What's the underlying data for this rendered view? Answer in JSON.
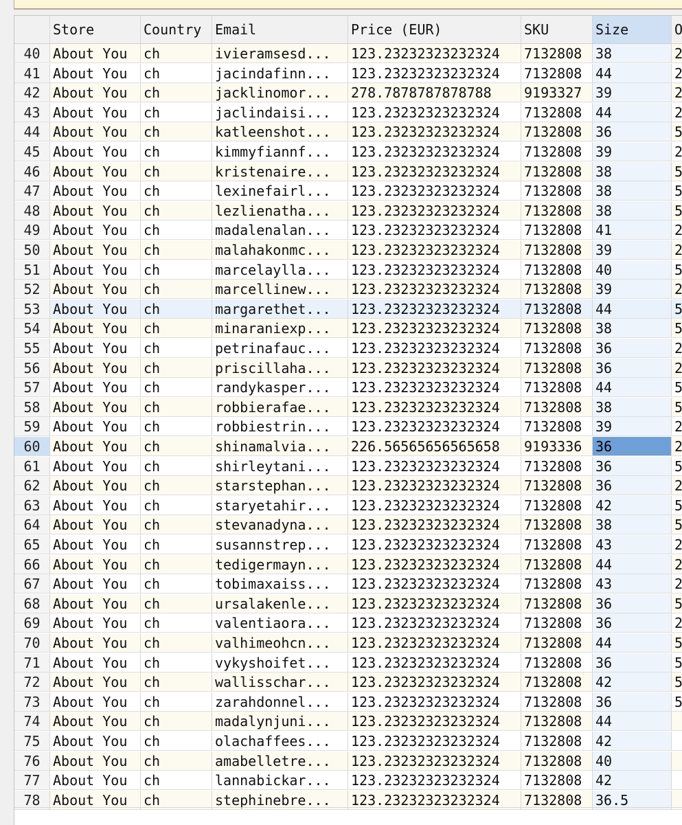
{
  "columns": [
    "Store",
    "Country",
    "Email",
    "Price (EUR)",
    "SKU",
    "Size",
    "O"
  ],
  "selected_column": "Size",
  "active_row": "60",
  "highlight_rows": [
    "53"
  ],
  "rows": [
    {
      "n": "40",
      "store": "About You",
      "country": "ch",
      "email": "ivieramsesd...",
      "price": "123.23232323232324",
      "sku": "7132808",
      "size": "38",
      "o": "2"
    },
    {
      "n": "41",
      "store": "About You",
      "country": "ch",
      "email": "jacindafinn...",
      "price": "123.23232323232324",
      "sku": "7132808",
      "size": "44",
      "o": "2"
    },
    {
      "n": "42",
      "store": "About You",
      "country": "ch",
      "email": "jacklinomor...",
      "price": "278.7878787878788",
      "sku": "9193327",
      "size": "39",
      "o": "2"
    },
    {
      "n": "43",
      "store": "About You",
      "country": "ch",
      "email": "jaclindaisi...",
      "price": "123.23232323232324",
      "sku": "7132808",
      "size": "44",
      "o": "2"
    },
    {
      "n": "44",
      "store": "About You",
      "country": "ch",
      "email": "katleenshot...",
      "price": "123.23232323232324",
      "sku": "7132808",
      "size": "36",
      "o": "5"
    },
    {
      "n": "45",
      "store": "About You",
      "country": "ch",
      "email": "kimmyfiannf...",
      "price": "123.23232323232324",
      "sku": "7132808",
      "size": "39",
      "o": "2"
    },
    {
      "n": "46",
      "store": "About You",
      "country": "ch",
      "email": "kristenaire...",
      "price": "123.23232323232324",
      "sku": "7132808",
      "size": "38",
      "o": "5"
    },
    {
      "n": "47",
      "store": "About You",
      "country": "ch",
      "email": "lexinefairl...",
      "price": "123.23232323232324",
      "sku": "7132808",
      "size": "38",
      "o": "5"
    },
    {
      "n": "48",
      "store": "About You",
      "country": "ch",
      "email": "lezlienatha...",
      "price": "123.23232323232324",
      "sku": "7132808",
      "size": "38",
      "o": "5"
    },
    {
      "n": "49",
      "store": "About You",
      "country": "ch",
      "email": "madalenalan...",
      "price": "123.23232323232324",
      "sku": "7132808",
      "size": "41",
      "o": "2"
    },
    {
      "n": "50",
      "store": "About You",
      "country": "ch",
      "email": "malahakonmc...",
      "price": "123.23232323232324",
      "sku": "7132808",
      "size": "39",
      "o": "2"
    },
    {
      "n": "51",
      "store": "About You",
      "country": "ch",
      "email": "marcelaylla...",
      "price": "123.23232323232324",
      "sku": "7132808",
      "size": "40",
      "o": "5"
    },
    {
      "n": "52",
      "store": "About You",
      "country": "ch",
      "email": "marcellinew...",
      "price": "123.23232323232324",
      "sku": "7132808",
      "size": "39",
      "o": "2"
    },
    {
      "n": "53",
      "store": "About You",
      "country": "ch",
      "email": "margarethet...",
      "price": "123.23232323232324",
      "sku": "7132808",
      "size": "44",
      "o": "5"
    },
    {
      "n": "54",
      "store": "About You",
      "country": "ch",
      "email": "minaraniexp...",
      "price": "123.23232323232324",
      "sku": "7132808",
      "size": "38",
      "o": "5"
    },
    {
      "n": "55",
      "store": "About You",
      "country": "ch",
      "email": "petrinafauc...",
      "price": "123.23232323232324",
      "sku": "7132808",
      "size": "36",
      "o": "2"
    },
    {
      "n": "56",
      "store": "About You",
      "country": "ch",
      "email": "priscillaha...",
      "price": "123.23232323232324",
      "sku": "7132808",
      "size": "36",
      "o": "2"
    },
    {
      "n": "57",
      "store": "About You",
      "country": "ch",
      "email": "randykasper...",
      "price": "123.23232323232324",
      "sku": "7132808",
      "size": "44",
      "o": "5"
    },
    {
      "n": "58",
      "store": "About You",
      "country": "ch",
      "email": "robbierafae...",
      "price": "123.23232323232324",
      "sku": "7132808",
      "size": "38",
      "o": "5"
    },
    {
      "n": "59",
      "store": "About You",
      "country": "ch",
      "email": "robbiestrin...",
      "price": "123.23232323232324",
      "sku": "7132808",
      "size": "39",
      "o": "2"
    },
    {
      "n": "60",
      "store": "About You",
      "country": "ch",
      "email": "shinamalvia...",
      "price": "226.56565656565658",
      "sku": "9193336",
      "size": "36",
      "o": "2"
    },
    {
      "n": "61",
      "store": "About You",
      "country": "ch",
      "email": "shirleytani...",
      "price": "123.23232323232324",
      "sku": "7132808",
      "size": "36",
      "o": "5"
    },
    {
      "n": "62",
      "store": "About You",
      "country": "ch",
      "email": "starstephan...",
      "price": "123.23232323232324",
      "sku": "7132808",
      "size": "36",
      "o": "2"
    },
    {
      "n": "63",
      "store": "About You",
      "country": "ch",
      "email": "staryetahir...",
      "price": "123.23232323232324",
      "sku": "7132808",
      "size": "42",
      "o": "5"
    },
    {
      "n": "64",
      "store": "About You",
      "country": "ch",
      "email": "stevanadyna...",
      "price": "123.23232323232324",
      "sku": "7132808",
      "size": "38",
      "o": "5"
    },
    {
      "n": "65",
      "store": "About You",
      "country": "ch",
      "email": "susannstrep...",
      "price": "123.23232323232324",
      "sku": "7132808",
      "size": "43",
      "o": "2"
    },
    {
      "n": "66",
      "store": "About You",
      "country": "ch",
      "email": "tedigermayn...",
      "price": "123.23232323232324",
      "sku": "7132808",
      "size": "44",
      "o": "2"
    },
    {
      "n": "67",
      "store": "About You",
      "country": "ch",
      "email": "tobimaxaiss...",
      "price": "123.23232323232324",
      "sku": "7132808",
      "size": "43",
      "o": "2"
    },
    {
      "n": "68",
      "store": "About You",
      "country": "ch",
      "email": "ursalakenle...",
      "price": "123.23232323232324",
      "sku": "7132808",
      "size": "36",
      "o": "5"
    },
    {
      "n": "69",
      "store": "About You",
      "country": "ch",
      "email": "valentiaora...",
      "price": "123.23232323232324",
      "sku": "7132808",
      "size": "36",
      "o": "2"
    },
    {
      "n": "70",
      "store": "About You",
      "country": "ch",
      "email": "valhimeohcn...",
      "price": "123.23232323232324",
      "sku": "7132808",
      "size": "44",
      "o": "5"
    },
    {
      "n": "71",
      "store": "About You",
      "country": "ch",
      "email": "vykyshoifet...",
      "price": "123.23232323232324",
      "sku": "7132808",
      "size": "36",
      "o": "5"
    },
    {
      "n": "72",
      "store": "About You",
      "country": "ch",
      "email": "wallisschar...",
      "price": "123.23232323232324",
      "sku": "7132808",
      "size": "42",
      "o": "5"
    },
    {
      "n": "73",
      "store": "About You",
      "country": "ch",
      "email": "zarahdonnel...",
      "price": "123.23232323232324",
      "sku": "7132808",
      "size": "36",
      "o": "5"
    },
    {
      "n": "74",
      "store": "About You",
      "country": "ch",
      "email": "madalynjuni...",
      "price": "123.23232323232324",
      "sku": "7132808",
      "size": "44",
      "o": ""
    },
    {
      "n": "75",
      "store": "About You",
      "country": "ch",
      "email": "olachaffees...",
      "price": "123.23232323232324",
      "sku": "7132808",
      "size": "42",
      "o": ""
    },
    {
      "n": "76",
      "store": "About You",
      "country": "ch",
      "email": "amabelletre...",
      "price": "123.23232323232324",
      "sku": "7132808",
      "size": "40",
      "o": ""
    },
    {
      "n": "77",
      "store": "About You",
      "country": "ch",
      "email": "lannabickar...",
      "price": "123.23232323232324",
      "sku": "7132808",
      "size": "42",
      "o": ""
    },
    {
      "n": "78",
      "store": "About You",
      "country": "ch",
      "email": "stephinebre...",
      "price": "123.23232323232324",
      "sku": "7132808",
      "size": "36.5",
      "o": ""
    }
  ]
}
